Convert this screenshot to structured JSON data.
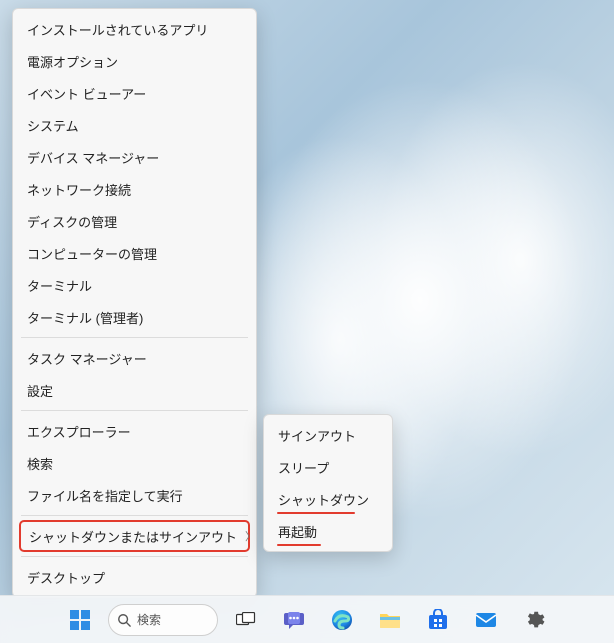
{
  "winx_menu": {
    "items": [
      {
        "label": "インストールされているアプリ",
        "name": "menu-item-installed-apps"
      },
      {
        "label": "電源オプション",
        "name": "menu-item-power-options"
      },
      {
        "label": "イベント ビューアー",
        "name": "menu-item-event-viewer"
      },
      {
        "label": "システム",
        "name": "menu-item-system"
      },
      {
        "label": "デバイス マネージャー",
        "name": "menu-item-device-manager"
      },
      {
        "label": "ネットワーク接続",
        "name": "menu-item-network-connections"
      },
      {
        "label": "ディスクの管理",
        "name": "menu-item-disk-management"
      },
      {
        "label": "コンピューターの管理",
        "name": "menu-item-computer-management"
      },
      {
        "label": "ターミナル",
        "name": "menu-item-terminal"
      },
      {
        "label": "ターミナル (管理者)",
        "name": "menu-item-terminal-admin"
      },
      {
        "sep": true
      },
      {
        "label": "タスク マネージャー",
        "name": "menu-item-task-manager"
      },
      {
        "label": "設定",
        "name": "menu-item-settings"
      },
      {
        "sep": true
      },
      {
        "label": "エクスプローラー",
        "name": "menu-item-file-explorer"
      },
      {
        "label": "検索",
        "name": "menu-item-search"
      },
      {
        "label": "ファイル名を指定して実行",
        "name": "menu-item-run"
      },
      {
        "sep": true
      },
      {
        "label": "シャットダウンまたはサインアウト",
        "name": "menu-item-shutdown-signout",
        "submenu": true,
        "highlighted": true
      },
      {
        "sep": true
      },
      {
        "label": "デスクトップ",
        "name": "menu-item-desktop"
      }
    ]
  },
  "submenu": {
    "items": [
      {
        "label": "サインアウト",
        "name": "submenu-item-sign-out"
      },
      {
        "label": "スリープ",
        "name": "submenu-item-sleep"
      },
      {
        "label": "シャットダウン",
        "name": "submenu-item-shut-down",
        "underline": true
      },
      {
        "label": "再起動",
        "name": "submenu-item-restart",
        "underline": true
      }
    ]
  },
  "taskbar": {
    "search_placeholder": "検索",
    "icons": [
      {
        "name": "start-button",
        "icon": "windows-icon"
      },
      {
        "name": "search-box",
        "icon": "search-icon"
      },
      {
        "name": "task-view-button",
        "icon": "task-view-icon"
      },
      {
        "name": "chat-button",
        "icon": "chat-icon"
      },
      {
        "name": "edge-button",
        "icon": "edge-icon"
      },
      {
        "name": "file-explorer-button",
        "icon": "folder-icon"
      },
      {
        "name": "store-button",
        "icon": "store-icon"
      },
      {
        "name": "mail-button",
        "icon": "mail-icon"
      },
      {
        "name": "settings-button",
        "icon": "gear-icon"
      }
    ]
  },
  "annotations": {
    "highlight_color": "#e23b2e",
    "underlined_items": [
      "シャットダウン",
      "再起動"
    ]
  }
}
